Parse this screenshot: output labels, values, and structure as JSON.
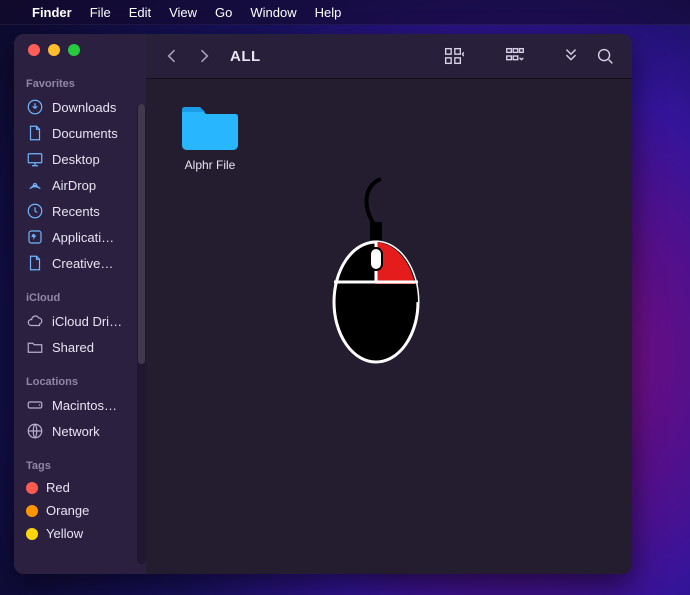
{
  "menubar": {
    "app_name": "Finder",
    "items": [
      "File",
      "Edit",
      "View",
      "Go",
      "Window",
      "Help"
    ]
  },
  "window": {
    "title": "ALL"
  },
  "sidebar": {
    "sections": {
      "favorites_label": "Favorites",
      "icloud_label": "iCloud",
      "locations_label": "Locations",
      "tags_label": "Tags"
    },
    "favorites": [
      {
        "label": "Downloads",
        "icon": "download-icon"
      },
      {
        "label": "Documents",
        "icon": "document-icon"
      },
      {
        "label": "Desktop",
        "icon": "desktop-icon"
      },
      {
        "label": "AirDrop",
        "icon": "airdrop-icon"
      },
      {
        "label": "Recents",
        "icon": "clock-icon"
      },
      {
        "label": "Applicati…",
        "icon": "applications-icon"
      },
      {
        "label": "Creative…",
        "icon": "document-icon"
      }
    ],
    "icloud": [
      {
        "label": "iCloud Dri…",
        "icon": "cloud-icon"
      },
      {
        "label": "Shared",
        "icon": "shared-folder-icon"
      }
    ],
    "locations": [
      {
        "label": "Macintos…",
        "icon": "disk-icon"
      },
      {
        "label": "Network",
        "icon": "network-icon"
      }
    ],
    "tags": [
      {
        "label": "Red",
        "color": "#ff5b50"
      },
      {
        "label": "Orange",
        "color": "#ff9500"
      },
      {
        "label": "Yellow",
        "color": "#ffd60a"
      }
    ]
  },
  "content": {
    "items": [
      {
        "label": "Alphr File"
      }
    ]
  }
}
